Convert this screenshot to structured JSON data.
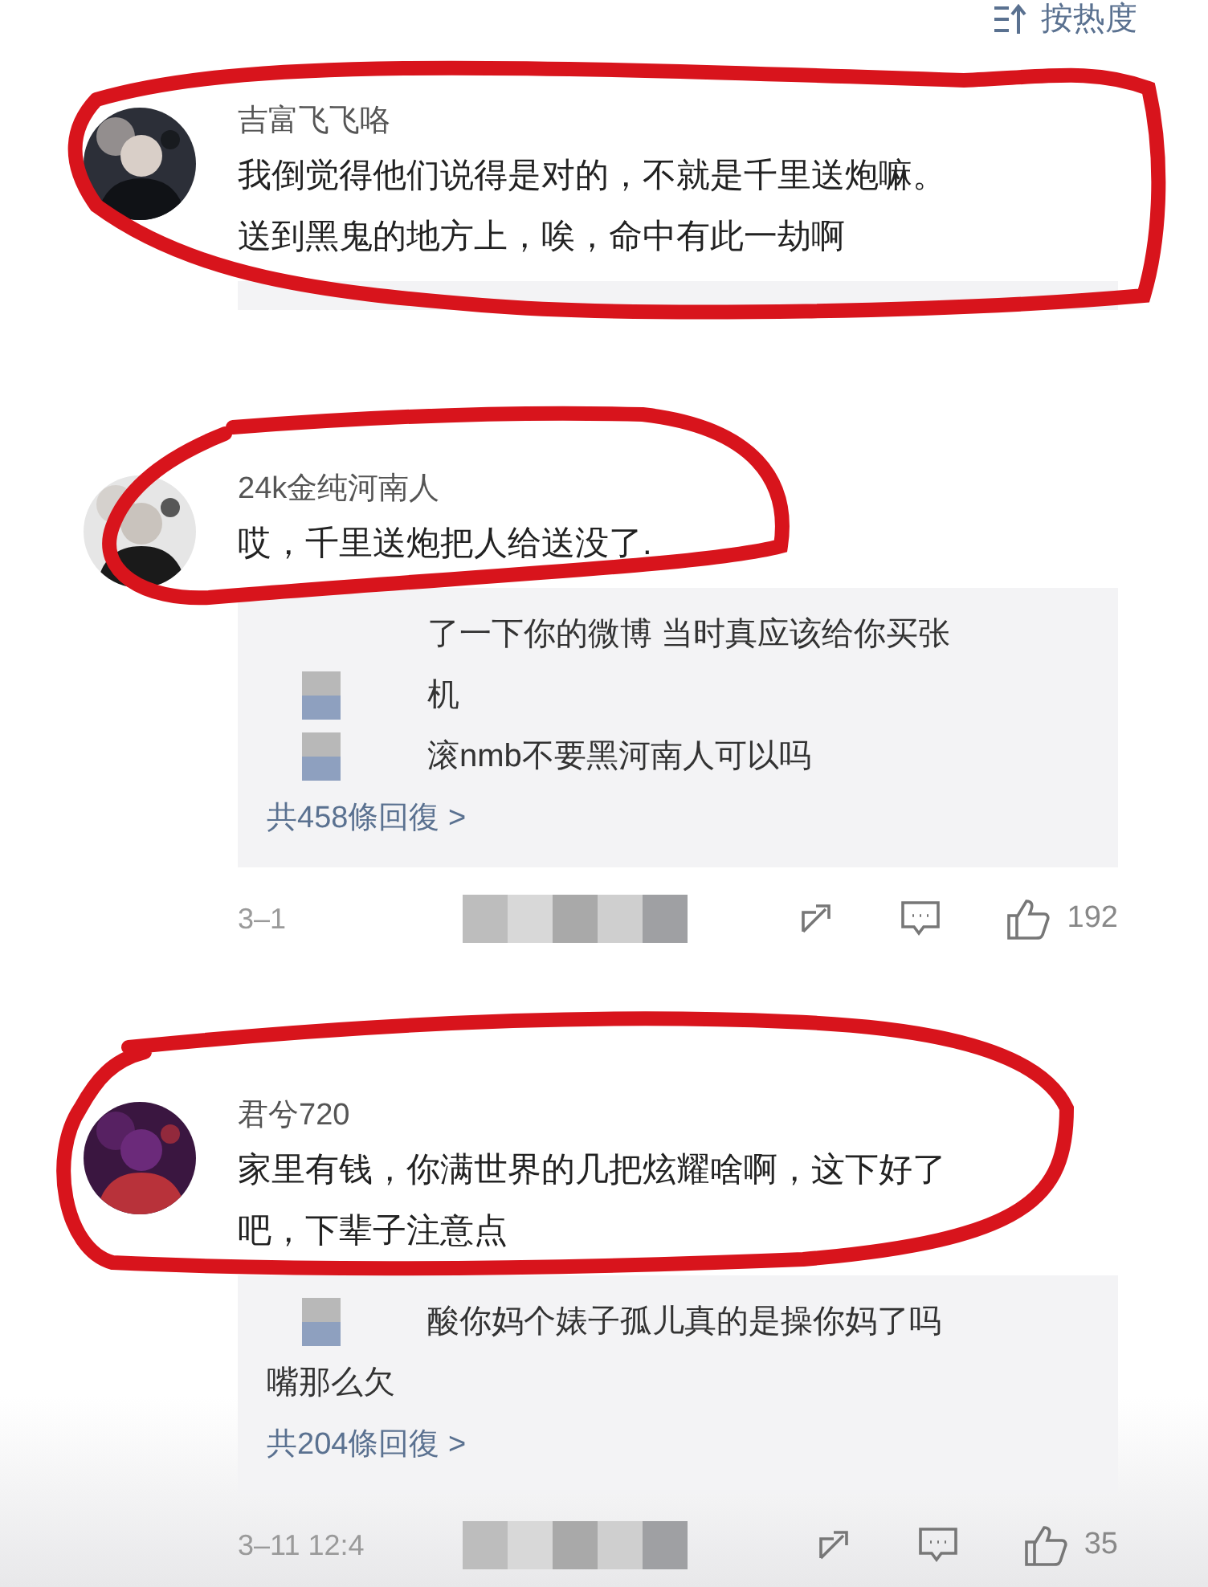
{
  "sort": {
    "label": "按热度"
  },
  "comments": [
    {
      "name": "吉富飞飞咯",
      "lines": [
        "我倒觉得他们说得是对的，不就是千里送炮嘛。",
        "送到黑鬼的地方上，唉，命中有此一劫啊"
      ],
      "reply": {
        "clipped": true
      }
    },
    {
      "name": "24k金纯河南人",
      "lines": [
        "哎，千里送炮把人给送没了."
      ],
      "reply": {
        "clipped": false,
        "lines": [
          {
            "text": "了一下你的微博  当时真应该给你买张",
            "kind": "blank"
          },
          {
            "text": "机",
            "kind": "mosaic"
          },
          {
            "text": "滚nmb不要黑河南人可以吗",
            "kind": "mosaic"
          }
        ],
        "more": "共458條回復 >"
      },
      "footer": {
        "time": "3–1",
        "likes": "192"
      }
    },
    {
      "name": "君兮720",
      "lines": [
        "家里有钱，你满世界的几把炫耀啥啊，这下好了",
        "吧，下辈子注意点"
      ],
      "reply": {
        "clipped": false,
        "lines": [
          {
            "text": "酸你妈个婊子孤儿真的是操你妈了吗",
            "kind": "mosaic"
          },
          {
            "text": "嘴那么欠",
            "kind": "plain"
          }
        ],
        "more": "共204條回復 >"
      },
      "footer": {
        "time": "3–11 12:4",
        "likes": "35"
      }
    }
  ]
}
